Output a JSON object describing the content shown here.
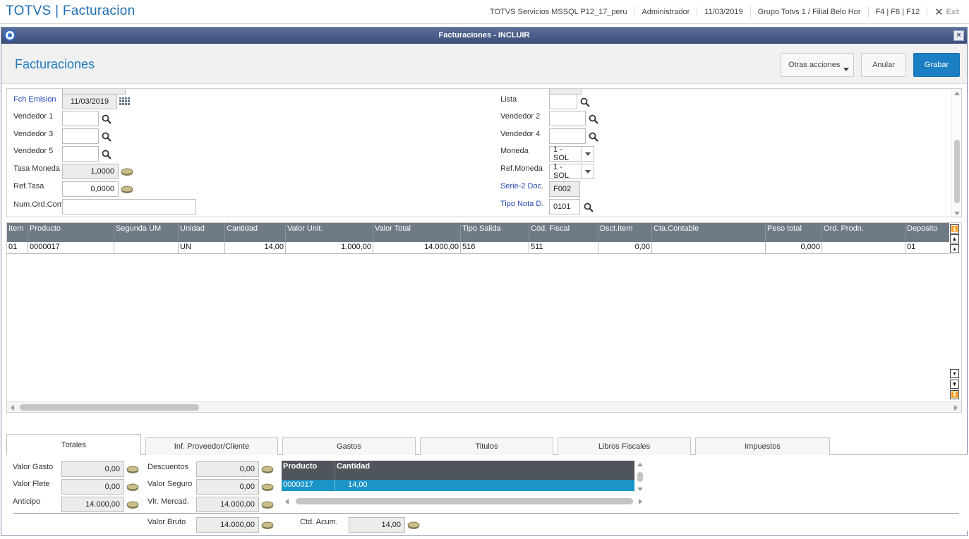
{
  "topbar": {
    "title": "TOTVS | Facturacion",
    "server": "TOTVS Servicios MSSQL P12_17_peru",
    "user": "Administrador",
    "date": "11/03/2019",
    "branch": "Grupo Totvs 1 / Filial Belo Hor",
    "shortcuts": "F4 | F8 | F12",
    "exit": "Exit"
  },
  "dialog": {
    "title": "Facturaciones - INCLUIR",
    "page_title": "Facturaciones",
    "btn_otras": "Otras acciones",
    "btn_anular": "Anular",
    "btn_grabar": "Grabar"
  },
  "form": {
    "fch_emision_label": "Fch Emision",
    "fch_emision_value": "11/03/2019",
    "vendedor1_label": "Vendedor 1",
    "vendedor3_label": "Vendedor 3",
    "vendedor5_label": "Vendedor 5",
    "tasa_moneda_label": "Tasa Moneda",
    "tasa_moneda_value": "1,0000",
    "ref_tasa_label": "Ref.Tasa",
    "ref_tasa_value": "0,0000",
    "num_ord_label": "Num.Ord.Com.",
    "lista_label": "Lista",
    "vendedor2_label": "Vendedor 2",
    "vendedor4_label": "Vendedor 4",
    "moneda_label": "Moneda",
    "moneda_value": "1 - SOL",
    "ref_moneda_label": "Ref.Moneda",
    "ref_moneda_value": "1 - SOL",
    "serie_label": "Serie-2 Doc.",
    "serie_value": "F002",
    "tipo_nota_label": "Tipo Nota D.",
    "tipo_nota_value": "0101"
  },
  "grid": {
    "columns": [
      "Item",
      "Producto",
      "Segunda UM",
      "Unidad",
      "Cantidad",
      "Valor Unit.",
      "Valor Total",
      "Tipo Salida",
      "Cód. Fiscal",
      "Dsct.Item",
      "Cta.Contable",
      "Peso total",
      "Ord. Prodn.",
      "Deposito"
    ],
    "rows": [
      [
        "01",
        "0000017",
        "",
        "UN",
        "14,00",
        "1.000,00",
        "14.000,00",
        "516",
        "511",
        "0,00",
        "",
        "0,000",
        "",
        "01"
      ]
    ]
  },
  "tabs": [
    "Totales",
    "Inf. Proveedor/Cliente",
    "Gastos",
    "Titulos",
    "Libros Fiscales",
    "Impuestos"
  ],
  "totals": {
    "valor_gasto_label": "Valor Gasto",
    "valor_gasto": "0,00",
    "valor_flete_label": "Valor Flete",
    "valor_flete": "0,00",
    "anticipo_label": "Anticipo",
    "anticipo": "14.000,00",
    "descuentos_label": "Descuentos",
    "descuentos": "0,00",
    "valor_seguro_label": "Valor Seguro",
    "valor_seguro": "0,00",
    "vlr_mercad_label": "Vlr. Mercad.",
    "vlr_mercad": "14.000,00",
    "valor_bruto_label": "Valor Bruto",
    "valor_bruto": "14.000,00",
    "ctd_acum_label": "Ctd. Acum.",
    "ctd_acum": "14,00",
    "mini_grid": {
      "columns": [
        "Producto",
        "Cantidad"
      ],
      "row": [
        "0000017",
        "14,00"
      ]
    }
  }
}
